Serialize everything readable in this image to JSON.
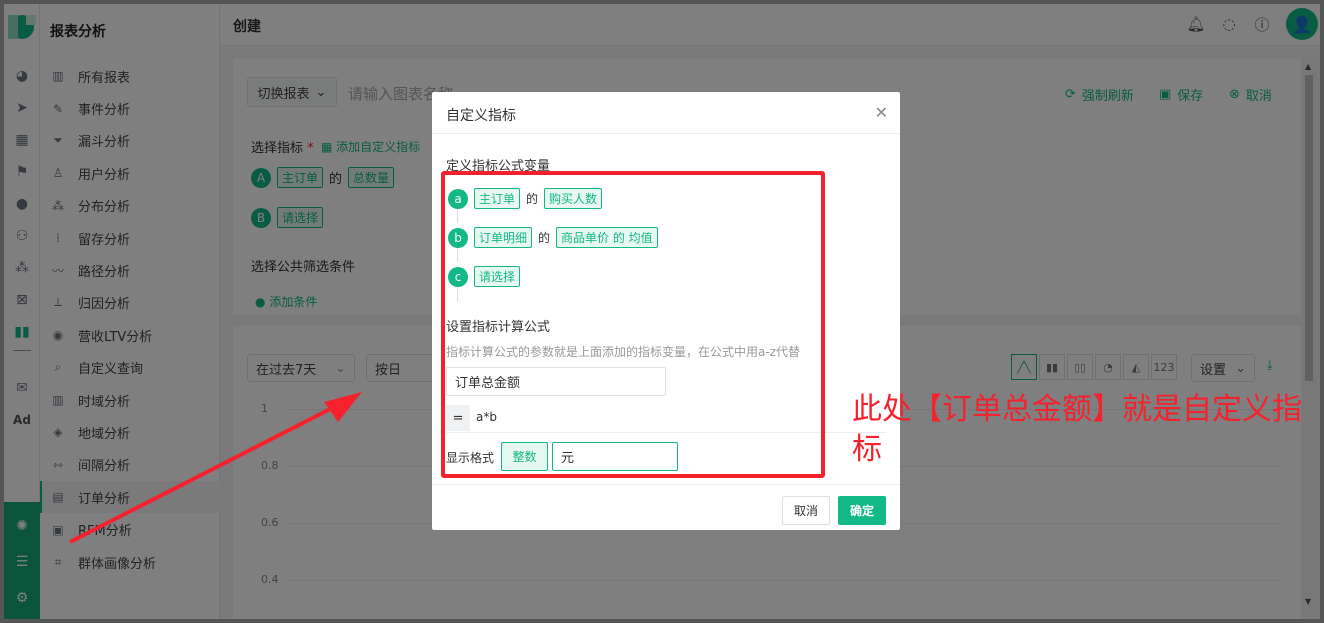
{
  "sidebar": {
    "title": "报表分析",
    "items": [
      {
        "label": "所有报表",
        "icon": "bar-chart-icon"
      },
      {
        "label": "事件分析",
        "icon": "edit-icon"
      },
      {
        "label": "漏斗分析",
        "icon": "funnel-icon"
      },
      {
        "label": "用户分析",
        "icon": "user-icon"
      },
      {
        "label": "分布分析",
        "icon": "cluster-icon"
      },
      {
        "label": "留存分析",
        "icon": "dots-icon"
      },
      {
        "label": "路径分析",
        "icon": "path-icon"
      },
      {
        "label": "归因分析",
        "icon": "attribution-icon"
      },
      {
        "label": "营收LTV分析",
        "icon": "revenue-icon"
      },
      {
        "label": "自定义查询",
        "icon": "query-icon"
      },
      {
        "label": "时域分析",
        "icon": "time-chart-icon"
      },
      {
        "label": "地域分析",
        "icon": "region-icon"
      },
      {
        "label": "间隔分析",
        "icon": "interval-icon"
      },
      {
        "label": "订单分析",
        "icon": "order-icon"
      },
      {
        "label": "RFM分析",
        "icon": "rfm-icon"
      },
      {
        "label": "群体画像分析",
        "icon": "portrait-icon"
      }
    ],
    "active_index": 13
  },
  "header": {
    "title": "创建",
    "avatar_glyph": "👤"
  },
  "report": {
    "switch_label": "切换报表",
    "name_placeholder": "请输入图表名称",
    "refresh": "强制刷新",
    "save": "保存",
    "cancel": "取消",
    "select_metric": "选择指标",
    "required_star": "*",
    "add_custom_metric": "添加自定义指标",
    "metric_a": {
      "letter": "A",
      "source": "主订单",
      "of": "的",
      "field": "总数量"
    },
    "metric_b": {
      "letter": "B",
      "source": "请选择"
    },
    "filter_title": "选择公共筛选条件",
    "add_condition": "添加条件"
  },
  "chart_panel": {
    "range": "在过去7天",
    "granularity": "按日",
    "settings": "设置",
    "chart_type_123": "123",
    "y_ticks": [
      "1",
      "0.8",
      "0.6",
      "0.4"
    ]
  },
  "modal": {
    "title": "自定义指标",
    "vars_title": "定义指标公式变量",
    "vars": [
      {
        "letter": "a",
        "source": "主订单",
        "of": "的",
        "field": "购买人数"
      },
      {
        "letter": "b",
        "source": "订单明细",
        "of": "的",
        "field": "商品单价 的 均值"
      },
      {
        "letter": "c",
        "source": "请选择"
      }
    ],
    "formula_title": "设置指标计算公式",
    "formula_hint": "指标计算公式的参数就是上面添加的指标变量，在公式中用a-z代替",
    "metric_name": "订单总金额",
    "equals": "=",
    "formula": "a*b",
    "format_label": "显示格式",
    "format_value": "整数",
    "unit": "元",
    "cancel": "取消",
    "confirm": "确定"
  },
  "annotation": {
    "text": "此处【订单总金额】就是自定义指标",
    "color": "#f5222d"
  },
  "colors": {
    "accent": "#12b886",
    "annotation": "#f5222d"
  }
}
